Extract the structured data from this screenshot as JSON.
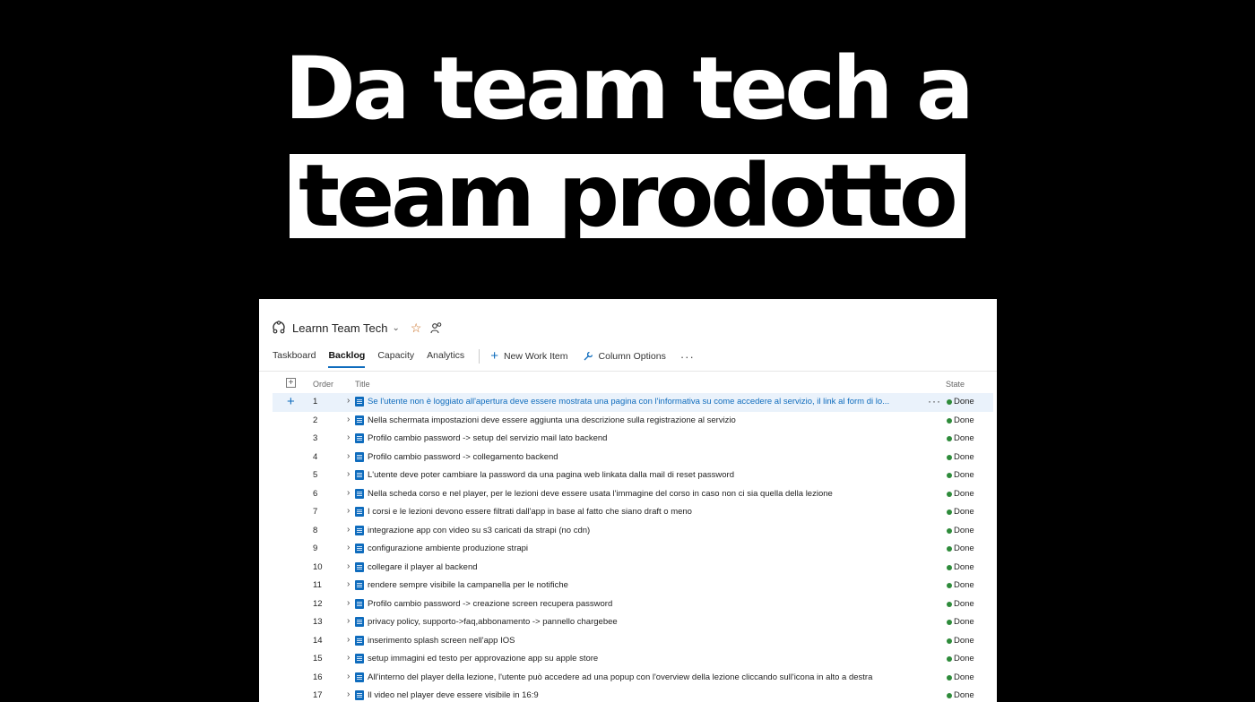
{
  "headline": {
    "line1": "Da team tech a",
    "line2": "team prodotto"
  },
  "board": {
    "project_name": "Learnn Team Tech",
    "tabs": [
      {
        "label": "Taskboard",
        "active": false
      },
      {
        "label": "Backlog",
        "active": true
      },
      {
        "label": "Capacity",
        "active": false
      },
      {
        "label": "Analytics",
        "active": false
      }
    ],
    "actions": {
      "new_work_item": "New Work Item",
      "column_options": "Column Options",
      "more": "···"
    },
    "columns": {
      "order": "Order",
      "title": "Title",
      "state": "State"
    },
    "accent_color": "#0f6cbd",
    "done_color": "#2e8b3a",
    "items": [
      {
        "order": "1",
        "title": "Se l'utente non è loggiato all'apertura deve essere mostrata una pagina con l'informativa su come accedere al servizio, il link al form di lo...",
        "state": "Done"
      },
      {
        "order": "2",
        "title": "Nella schermata impostazioni deve essere aggiunta una descrizione sulla registrazione al servizio",
        "state": "Done"
      },
      {
        "order": "3",
        "title": "Profilo cambio password -> setup del servizio mail lato backend",
        "state": "Done"
      },
      {
        "order": "4",
        "title": "Profilo cambio password -> collegamento backend",
        "state": "Done"
      },
      {
        "order": "5",
        "title": "L'utente deve poter cambiare la password da una pagina web linkata dalla mail di reset password",
        "state": "Done"
      },
      {
        "order": "6",
        "title": "Nella scheda corso e nel player, per le lezioni deve essere usata l'immagine del corso in caso non ci sia quella della lezione",
        "state": "Done"
      },
      {
        "order": "7",
        "title": "I corsi e le lezioni devono essere filtrati dall'app in base al fatto che siano draft o meno",
        "state": "Done"
      },
      {
        "order": "8",
        "title": "integrazione app con video su s3 caricati da strapi (no cdn)",
        "state": "Done"
      },
      {
        "order": "9",
        "title": "configurazione ambiente produzione strapi",
        "state": "Done"
      },
      {
        "order": "10",
        "title": "collegare il player al backend",
        "state": "Done"
      },
      {
        "order": "11",
        "title": "rendere sempre visibile la campanella per le notifiche",
        "state": "Done"
      },
      {
        "order": "12",
        "title": "Profilo cambio password -> creazione screen recupera password",
        "state": "Done"
      },
      {
        "order": "13",
        "title": "privacy policy, supporto->faq,abbonamento -> pannello chargebee",
        "state": "Done"
      },
      {
        "order": "14",
        "title": "inserimento splash screen nell'app IOS",
        "state": "Done"
      },
      {
        "order": "15",
        "title": "setup immagini ed testo per approvazione app su apple store",
        "state": "Done"
      },
      {
        "order": "16",
        "title": "All'interno del player della lezione, l'utente può accedere ad una popup con l'overview della lezione cliccando sull'icona in alto a destra",
        "state": "Done"
      },
      {
        "order": "17",
        "title": "Il video nel player deve essere visibile in 16:9",
        "state": "Done"
      }
    ]
  }
}
